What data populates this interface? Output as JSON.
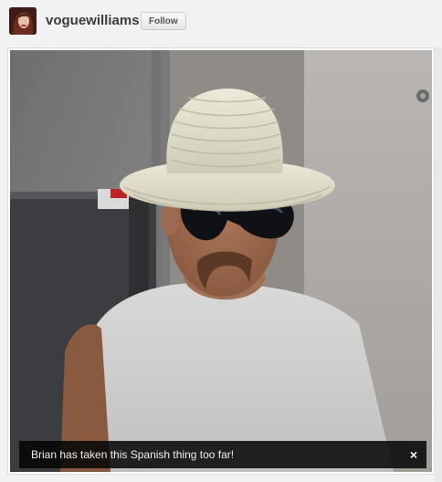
{
  "header": {
    "username": "voguewilliams",
    "follow_label": "Follow"
  },
  "photo": {
    "caption": "Brian has taken this Spanish thing too far!",
    "close_glyph": "×"
  },
  "colors": {
    "background": "#f2f2f3",
    "caption_bg": "#0d0d0d",
    "username": "#3b3b3b"
  }
}
